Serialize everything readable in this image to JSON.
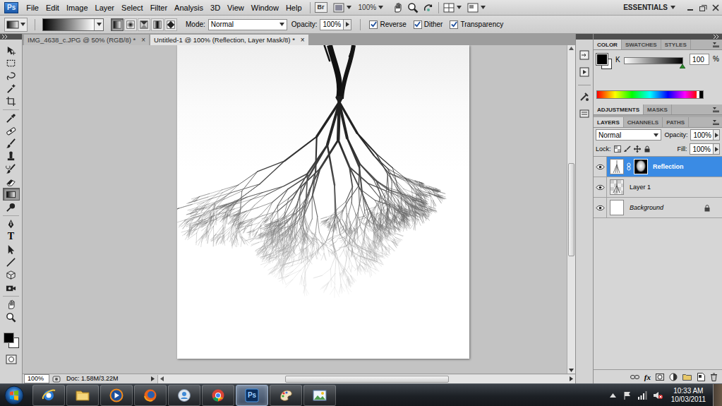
{
  "app_bar": {
    "logo": "Ps",
    "menu": [
      "File",
      "Edit",
      "Image",
      "Layer",
      "Select",
      "Filter",
      "Analysis",
      "3D",
      "View",
      "Window",
      "Help"
    ],
    "bridge": "Br",
    "zoom": "100%",
    "workspace": "ESSENTIALS"
  },
  "options_bar": {
    "gradient_types": [
      {
        "selected": true
      },
      {
        "selected": false
      },
      {
        "selected": false
      },
      {
        "selected": false
      },
      {
        "selected": false
      }
    ],
    "mode_label": "Mode:",
    "mode": "Normal",
    "opacity_label": "Opacity:",
    "opacity": "100%",
    "checks": [
      {
        "label": "Reverse",
        "checked": true
      },
      {
        "label": "Dither",
        "checked": true
      },
      {
        "label": "Transparency",
        "checked": true
      }
    ]
  },
  "tools": [
    {
      "selected": false
    },
    {
      "selected": false
    },
    {
      "selected": false
    },
    {
      "selected": false
    },
    {
      "selected": false
    },
    {
      "selected": false
    },
    {
      "selected": false
    },
    {
      "selected": false
    },
    {
      "selected": false
    },
    {
      "selected": false
    },
    {
      "selected": false
    },
    {
      "selected": true
    },
    {
      "selected": false
    },
    {
      "selected": false
    },
    {
      "selected": false,
      "label": "T"
    },
    {
      "selected": false
    },
    {
      "selected": false
    },
    {
      "selected": false
    },
    {
      "selected": false
    },
    {
      "selected": false
    },
    {
      "selected": false
    }
  ],
  "documents": [
    {
      "label": "IMG_4638_c.JPG @ 50% (RGB/8) *",
      "close": "×",
      "selected": false
    },
    {
      "label": "Untitled-1 @ 100% (Reflection, Layer Mask/8) *",
      "close": "×",
      "selected": true
    }
  ],
  "status_bar": {
    "zoom": "100%",
    "doc": "Doc: 1.58M/3.22M"
  },
  "color_panel": {
    "tabs": [
      {
        "label": "COLOR",
        "selected": true
      },
      {
        "label": "SWATCHES",
        "selected": false
      },
      {
        "label": "STYLES",
        "selected": false
      }
    ],
    "channel": "K",
    "value": "100",
    "unit": "%",
    "level": 1
  },
  "adjustments_panel": {
    "tabs": [
      {
        "label": "ADJUSTMENTS",
        "selected": true
      },
      {
        "label": "MASKS",
        "selected": false
      }
    ]
  },
  "layers_panel": {
    "tabs": [
      {
        "label": "LAYERS",
        "selected": true
      },
      {
        "label": "CHANNELS",
        "selected": false
      },
      {
        "label": "PATHS",
        "selected": false
      }
    ],
    "blend": "Normal",
    "opacity_label": "Opacity:",
    "opacity": "100%",
    "lock_label": "Lock:",
    "fill_label": "Fill:",
    "fill": "100%",
    "effects_button": "fx",
    "layers": [
      {
        "name": "Reflection",
        "kind": "masked",
        "selected": true,
        "visible": true,
        "locked": false
      },
      {
        "name": "Layer 1",
        "kind": "pixel",
        "selected": false,
        "visible": true,
        "locked": false
      },
      {
        "name": "Background",
        "kind": "background",
        "selected": false,
        "visible": true,
        "locked": true
      }
    ]
  },
  "taskbar": {
    "apps": [
      {
        "kind": "ie",
        "selected": false
      },
      {
        "kind": "explorer",
        "selected": false
      },
      {
        "kind": "media",
        "selected": false
      },
      {
        "kind": "firefox",
        "selected": false
      },
      {
        "kind": "messenger",
        "selected": false
      },
      {
        "kind": "chrome",
        "selected": false
      },
      {
        "kind": "photoshop",
        "label": "Ps",
        "selected": true
      },
      {
        "kind": "paint",
        "selected": false
      },
      {
        "kind": "viewer",
        "selected": false
      }
    ],
    "time": "10:33 AM",
    "date": "10/03/2011"
  }
}
